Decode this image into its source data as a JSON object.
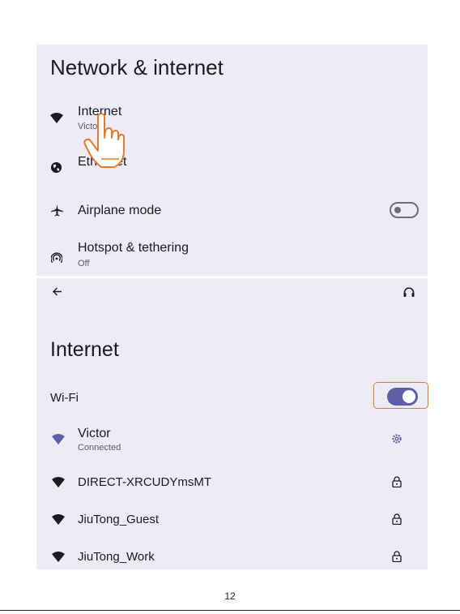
{
  "network_screen": {
    "title": "Network & internet",
    "items": [
      {
        "label": "Internet",
        "sublabel": "Victor",
        "icon": "wifi-icon"
      },
      {
        "label": "Ethernet",
        "icon": "ethernet-globe-icon"
      },
      {
        "label": "Airplane mode",
        "icon": "airplane-icon",
        "toggle": "off"
      },
      {
        "label": "Hotspot & tethering",
        "sublabel": "Off",
        "icon": "hotspot-icon"
      }
    ]
  },
  "internet_screen": {
    "title": "Internet",
    "wifi_label": "Wi-Fi",
    "wifi_toggle": "on",
    "networks": [
      {
        "name": "Victor",
        "status": "Connected",
        "action_icon": "gear-icon"
      },
      {
        "name": "DIRECT-XRCUDYmsMT",
        "action_icon": "lock-icon"
      },
      {
        "name": "JiuTong_Guest",
        "action_icon": "lock-icon"
      },
      {
        "name": "JiuTong_Work",
        "action_icon": "lock-icon"
      }
    ]
  },
  "colors": {
    "accent": "#5f5ea8",
    "highlight": "#e87a2c",
    "panel_bg": "#ecebf6"
  },
  "page_number": "12"
}
